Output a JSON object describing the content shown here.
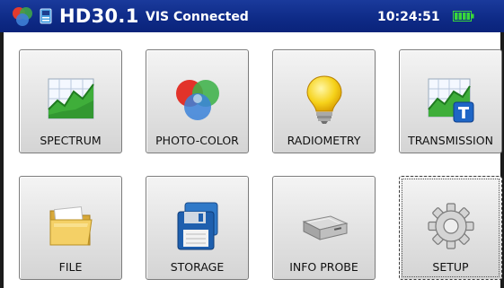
{
  "status_bar": {
    "model": "HD30.1",
    "connection_status": "VIS Connected",
    "time": "10:24:51",
    "battery_icon": "battery-full-icon",
    "battery_color": "#39d839",
    "background_color": "#0e2a86"
  },
  "menu": {
    "tiles": [
      {
        "label": "SPECTRUM",
        "icon": "spectrum-chart-icon"
      },
      {
        "label": "PHOTO-COLOR",
        "icon": "rgb-circles-icon"
      },
      {
        "label": "RADIOMETRY",
        "icon": "light-bulb-icon"
      },
      {
        "label": "TRANSMISSION",
        "icon": "transmission-chart-icon"
      },
      {
        "label": "FILE",
        "icon": "folder-icon"
      },
      {
        "label": "STORAGE",
        "icon": "floppy-disk-icon"
      },
      {
        "label": "INFO PROBE",
        "icon": "probe-drive-icon"
      },
      {
        "label": "SETUP",
        "icon": "gear-icon",
        "selected": true
      }
    ]
  }
}
